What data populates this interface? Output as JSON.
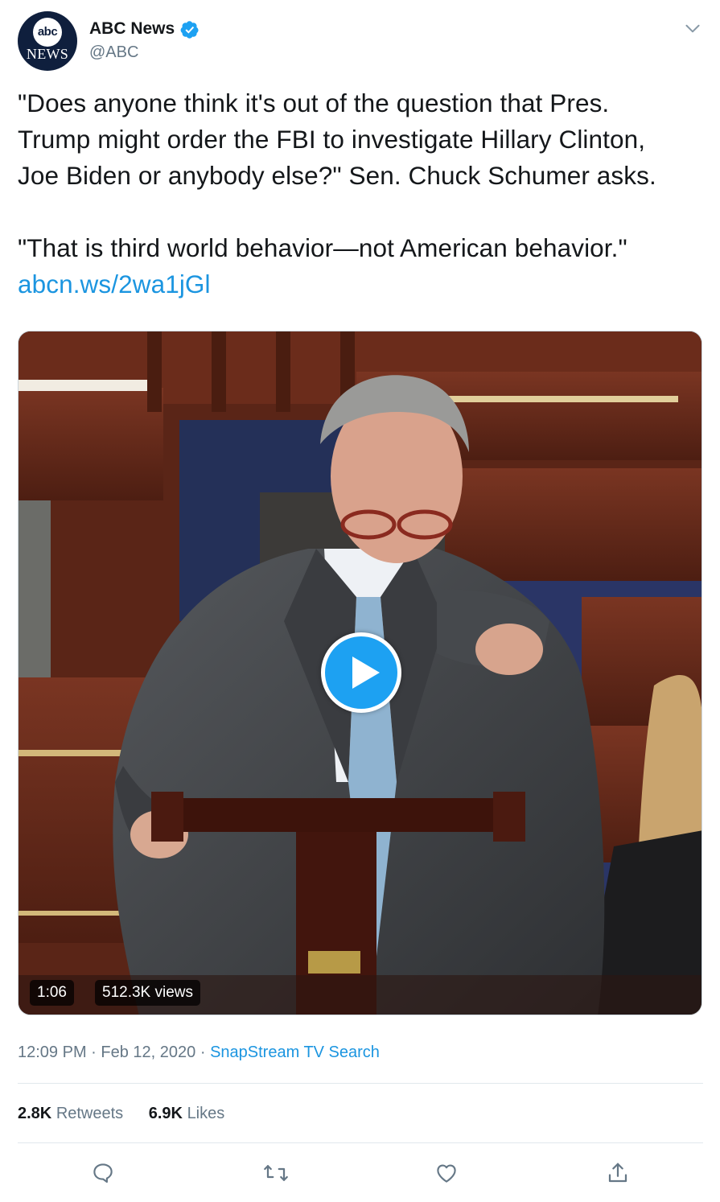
{
  "account": {
    "avatar_top": "abc",
    "avatar_bottom": "NEWS",
    "display_name": "ABC News",
    "handle": "@ABC",
    "verified": true
  },
  "tweet": {
    "text_lines_1": [
      "\"Does anyone think it's out of the question that Pres.",
      "Trump might order the FBI to investigate Hillary Clinton,",
      "Joe Biden or anybody else?\" Sen. Chuck Schumer asks."
    ],
    "text_line_2": "\"That is third world behavior—not American behavior.\"",
    "link": "abcn.ws/2wa1jGl"
  },
  "media": {
    "duration": "1:06",
    "views": "512.3K views"
  },
  "meta": {
    "time": "12:09 PM",
    "separator": "·",
    "date": "Feb 12, 2020",
    "source": "SnapStream TV Search"
  },
  "stats": {
    "retweets_count": "2.8K",
    "retweets_label": "Retweets",
    "likes_count": "6.9K",
    "likes_label": "Likes"
  },
  "actions": [
    "reply-icon",
    "retweet-icon",
    "like-icon",
    "share-icon"
  ],
  "colors": {
    "link": "#1b95e0",
    "verified": "#1da1f2",
    "secondary_text": "#657786",
    "divider": "#e1e8ed"
  }
}
